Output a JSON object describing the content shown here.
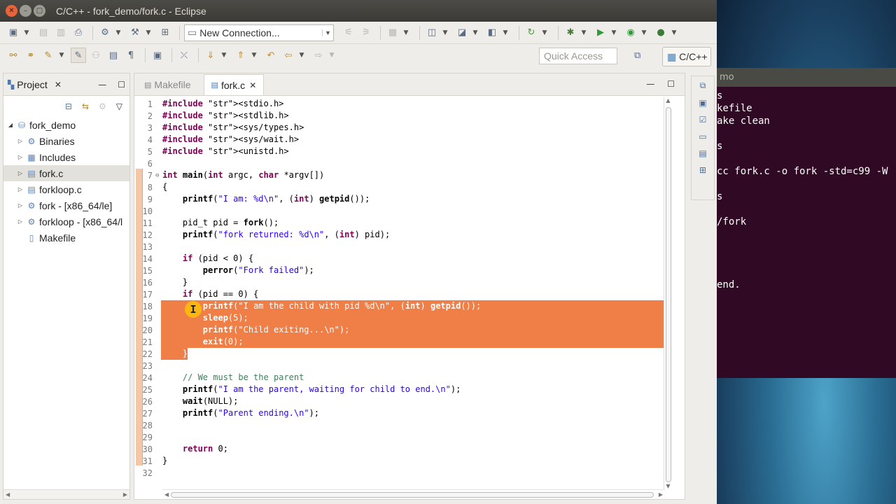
{
  "window": {
    "title": "C/C++ - fork_demo/fork.c - Eclipse"
  },
  "toolbar": {
    "connection_value": "New Connection...",
    "quick_access_placeholder": "Quick Access",
    "perspective_label": "C/C++"
  },
  "project": {
    "tab_label": "Project",
    "tree": [
      {
        "label": "fork_demo",
        "icon": "project-folder-icon",
        "level": 0,
        "expanded": true
      },
      {
        "label": "Binaries",
        "icon": "binaries-icon",
        "level": 1
      },
      {
        "label": "Includes",
        "icon": "includes-icon",
        "level": 1
      },
      {
        "label": "fork.c",
        "icon": "c-file-icon",
        "level": 1,
        "selected": true
      },
      {
        "label": "forkloop.c",
        "icon": "c-file-icon",
        "level": 1
      },
      {
        "label": "fork - [x86_64/le]",
        "icon": "binary-icon",
        "level": 1
      },
      {
        "label": "forkloop - [x86_64/l",
        "icon": "binary-icon",
        "level": 1
      },
      {
        "label": "Makefile",
        "icon": "file-icon",
        "level": 1,
        "leaf": true
      }
    ]
  },
  "editor": {
    "tabs": [
      {
        "label": "Makefile",
        "active": false
      },
      {
        "label": "fork.c",
        "active": true
      }
    ],
    "lines": [
      "#include <stdio.h>",
      "#include <stdlib.h>",
      "#include <sys/types.h>",
      "#include <sys/wait.h>",
      "#include <unistd.h>",
      "",
      "int main(int argc, char *argv[])",
      "{",
      "    printf(\"I am: %d\\n\", (int) getpid());",
      "",
      "    pid_t pid = fork();",
      "    printf(\"fork returned: %d\\n\", (int) pid);",
      "",
      "    if (pid < 0) {",
      "        perror(\"Fork failed\");",
      "    }",
      "    if (pid == 0) {",
      "        printf(\"I am the child with pid %d\\n\", (int) getpid());",
      "        sleep(5);",
      "        printf(\"Child exiting...\\n\");",
      "        exit(0);",
      "    }",
      "",
      "    // We must be the parent",
      "    printf(\"I am the parent, waiting for child to end.\\n\");",
      "    wait(NULL);",
      "    printf(\"Parent ending.\\n\");",
      "",
      "",
      "    return 0;",
      "}",
      ""
    ],
    "highlight_lines": [
      18,
      19,
      20,
      21,
      22
    ]
  },
  "terminal": {
    "title": "mo",
    "lines": [
      "s",
      "kefile",
      "ake clean",
      "",
      "s",
      "",
      "cc fork.c -o fork -std=c99 -W",
      "",
      "s",
      "",
      "/fork",
      "",
      "",
      "",
      "",
      "end."
    ]
  }
}
